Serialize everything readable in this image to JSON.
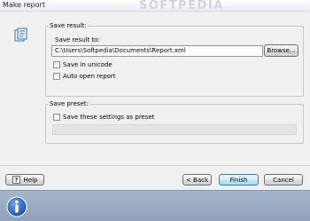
{
  "window": {
    "title": "Make report",
    "watermark": "SOFTPEDIA"
  },
  "icons": {
    "header": "report-icon",
    "help": "help-icon",
    "info": "info-icon",
    "accent": "#2a63b8"
  },
  "save_result": {
    "group_label": "Save result:",
    "save_to_label": "Save result to:",
    "path_value": "C:\\Users\\Softpedia\\Documents\\Report.xml",
    "browse_label": "Browse...",
    "unicode_label": "Save in unicode",
    "unicode_checked": false,
    "auto_open_label": "Auto open report",
    "auto_open_checked": false
  },
  "save_preset": {
    "group_label": "Save preset:",
    "save_settings_label": "Save these settings as preset",
    "save_settings_checked": false,
    "preset_name_value": ""
  },
  "buttons": {
    "help": "Help",
    "back": "< Back",
    "finish": "Finish",
    "cancel": "Cancel"
  }
}
